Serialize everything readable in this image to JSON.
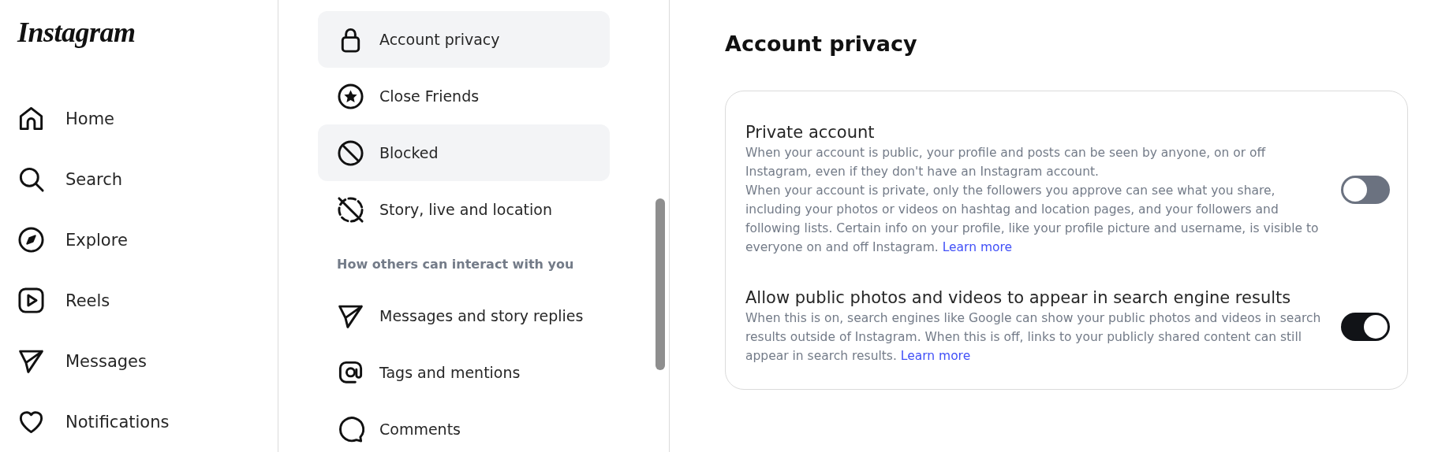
{
  "logo": "Instagram",
  "nav": [
    {
      "label": "Home"
    },
    {
      "label": "Search"
    },
    {
      "label": "Explore"
    },
    {
      "label": "Reels"
    },
    {
      "label": "Messages"
    },
    {
      "label": "Notifications"
    }
  ],
  "settings_menu": [
    {
      "kind": "item",
      "label": "Account privacy",
      "selected": true
    },
    {
      "kind": "item",
      "label": "Close Friends",
      "selected": false
    },
    {
      "kind": "item",
      "label": "Blocked",
      "selected": true
    },
    {
      "kind": "item",
      "label": "Story, live and location",
      "selected": false
    },
    {
      "kind": "heading",
      "label": "How others can interact with you"
    },
    {
      "kind": "item",
      "label": "Messages and story replies",
      "selected": false
    },
    {
      "kind": "item",
      "label": "Tags and mentions",
      "selected": false
    },
    {
      "kind": "item",
      "label": "Comments",
      "selected": false
    }
  ],
  "page_title": "Account privacy",
  "options": [
    {
      "title": "Private account",
      "description": [
        "When your account is public, your profile and posts can be seen by anyone, on or off Instagram, even if they don't have an Instagram account.",
        "When your account is private, only the followers you approve can see what you share, including your photos or videos on hashtag and location pages, and your followers and following lists. Certain info on your profile, like your profile picture and username, is visible to everyone on and off Instagram."
      ],
      "link": "Learn more",
      "on": false
    },
    {
      "title": "Allow public photos and videos to appear in search engine results",
      "description": [
        "When this is on, search engines like Google can show your public photos and videos in search results outside of Instagram. When this is off, links to your publicly shared content can still appear in search results."
      ],
      "link": "Learn more",
      "on": true
    }
  ]
}
